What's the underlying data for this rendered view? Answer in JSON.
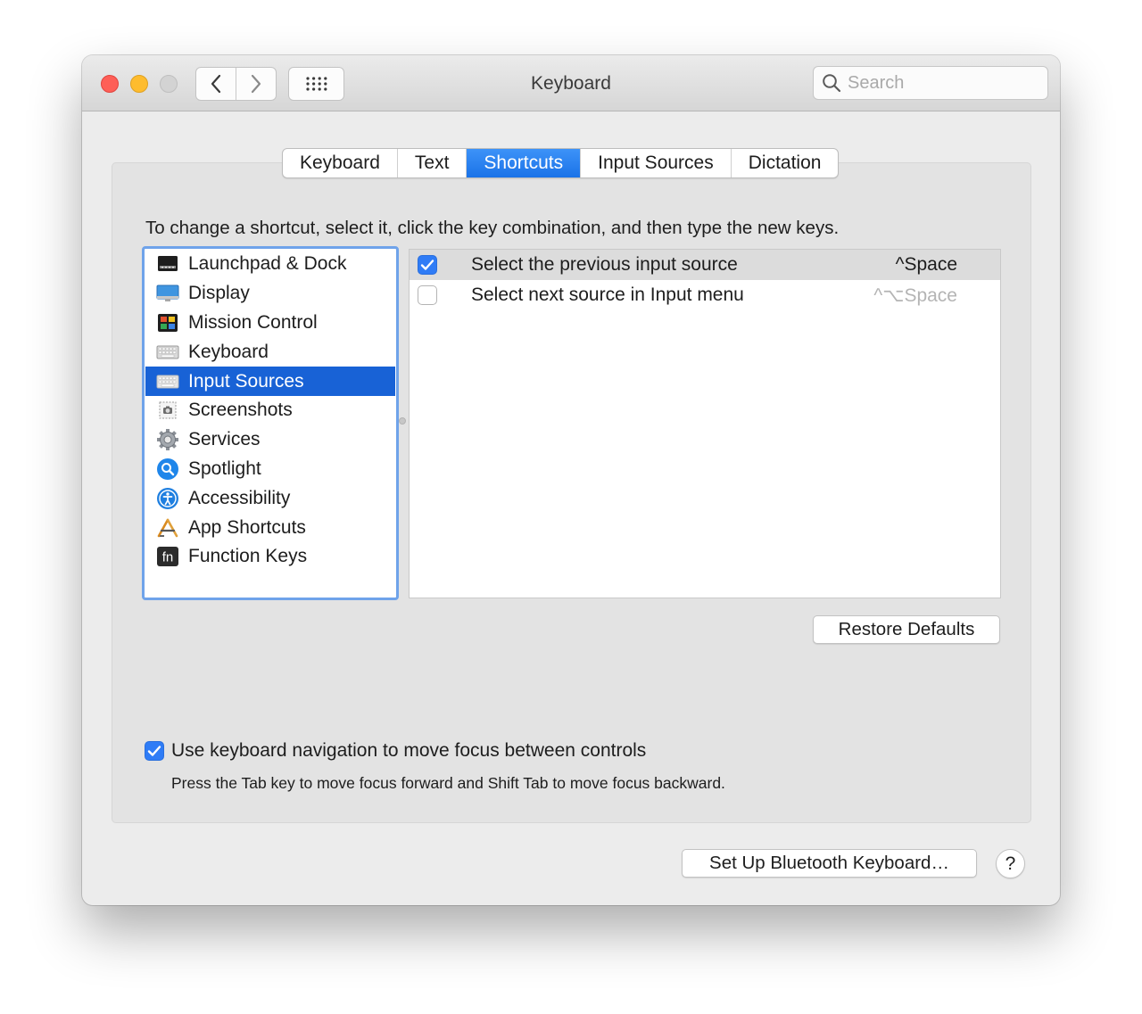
{
  "window": {
    "title": "Keyboard",
    "search": {
      "placeholder": "Search",
      "value": ""
    }
  },
  "tabs": [
    {
      "label": "Keyboard",
      "active": false
    },
    {
      "label": "Text",
      "active": false
    },
    {
      "label": "Shortcuts",
      "active": true
    },
    {
      "label": "Input Sources",
      "active": false
    },
    {
      "label": "Dictation",
      "active": false
    }
  ],
  "instructions": "To change a shortcut, select it, click the key combination, and then type the new keys.",
  "categories": [
    {
      "label": "Launchpad & Dock",
      "icon": "launchpad-dock-icon",
      "selected": false
    },
    {
      "label": "Display",
      "icon": "display-icon",
      "selected": false
    },
    {
      "label": "Mission Control",
      "icon": "mission-control-icon",
      "selected": false
    },
    {
      "label": "Keyboard",
      "icon": "keyboard-icon",
      "selected": false
    },
    {
      "label": "Input Sources",
      "icon": "input-sources-icon",
      "selected": true
    },
    {
      "label": "Screenshots",
      "icon": "screenshots-icon",
      "selected": false
    },
    {
      "label": "Services",
      "icon": "services-gear-icon",
      "selected": false
    },
    {
      "label": "Spotlight",
      "icon": "spotlight-icon",
      "selected": false
    },
    {
      "label": "Accessibility",
      "icon": "accessibility-icon",
      "selected": false
    },
    {
      "label": "App Shortcuts",
      "icon": "app-shortcuts-icon",
      "selected": false
    },
    {
      "label": "Function Keys",
      "icon": "function-keys-icon",
      "selected": false
    }
  ],
  "shortcuts": [
    {
      "label": "Select the previous input source",
      "key": "^Space",
      "checked": true,
      "selected": true
    },
    {
      "label": "Select next source in Input menu",
      "key": "^⌥Space",
      "checked": false,
      "selected": false
    }
  ],
  "buttons": {
    "restore_defaults": "Restore Defaults",
    "bluetooth": "Set Up Bluetooth Keyboard…",
    "help": "?"
  },
  "keyboard_navigation": {
    "label": "Use keyboard navigation to move focus between controls",
    "help_text": "Press the Tab key to move focus forward and Shift Tab to move focus backward.",
    "checked": true
  },
  "colors": {
    "accent": "#1a73e8",
    "selection": "#1862d6",
    "close": "#fe5f57",
    "minimize": "#febc2e",
    "zoom_disabled": "#d3d3d3"
  }
}
